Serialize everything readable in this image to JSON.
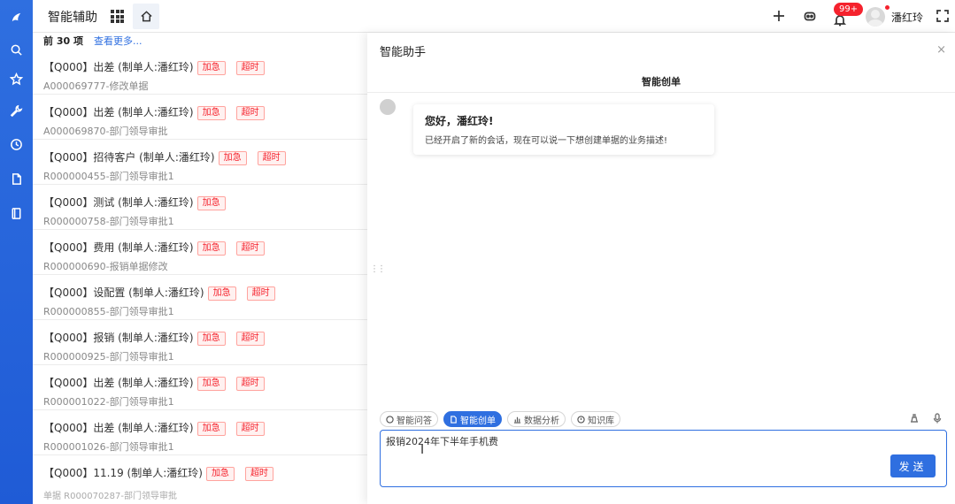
{
  "app": {
    "title": "智能辅助",
    "user": "潘红玲",
    "notification_count": "99+"
  },
  "list": {
    "header_count": "前 30 项",
    "header_more": "查看更多...",
    "rows": [
      {
        "title": "【Q000】出差 (制单人:潘红玲)",
        "tags": [
          "加急",
          "超时"
        ],
        "subtitle": "A000069777-修改单据"
      },
      {
        "title": "【Q000】出差 (制单人:潘红玲)",
        "tags": [
          "加急",
          "超时"
        ],
        "subtitle": "A000069870-部门领导审批"
      },
      {
        "title": "【Q000】招待客户 (制单人:潘红玲)",
        "tags": [
          "加急",
          "超时"
        ],
        "subtitle": "R000000455-部门领导审批1"
      },
      {
        "title": "【Q000】测试 (制单人:潘红玲)",
        "tags": [
          "加急"
        ],
        "subtitle": "R000000758-部门领导审批1"
      },
      {
        "title": "【Q000】费用 (制单人:潘红玲)",
        "tags": [
          "加急",
          "超时"
        ],
        "subtitle": "R000000690-报销单据修改"
      },
      {
        "title": "【Q000】设配置 (制单人:潘红玲)",
        "tags": [
          "加急",
          "超时"
        ],
        "subtitle": "R000000855-部门领导审批1"
      },
      {
        "title": "【Q000】报销 (制单人:潘红玲)",
        "tags": [
          "加急",
          "超时"
        ],
        "subtitle": "R000000925-部门领导审批1"
      },
      {
        "title": "【Q000】出差 (制单人:潘红玲)",
        "tags": [
          "加急",
          "超时"
        ],
        "subtitle": "R000001022-部门领导审批1"
      },
      {
        "title": "【Q000】出差 (制单人:潘红玲)",
        "tags": [
          "加急",
          "超时"
        ],
        "subtitle": "R000001026-部门领导审批1"
      },
      {
        "title": "【Q000】11.19 (制单人:潘红玲)",
        "tags": [
          "加急",
          "超时"
        ],
        "subtitle": ""
      }
    ],
    "footer": "单据 R000070287-部门领导审批"
  },
  "assistant": {
    "title": "智能助手",
    "close": "×",
    "sub_title": "智能创单",
    "greeting": "您好，潘红玲!",
    "message": "已经开启了新的会话，现在可以说一下想创建单据的业务描述!",
    "modes": [
      {
        "label": "智能问答",
        "icon": "chat-icon",
        "active": false
      },
      {
        "label": "智能创单",
        "icon": "doc-icon",
        "active": true
      },
      {
        "label": "数据分析",
        "icon": "chart-icon",
        "active": false
      },
      {
        "label": "知识库",
        "icon": "book-icon",
        "active": false
      }
    ],
    "input_value": "报销2024年下半年手机费",
    "send_label": "发送"
  },
  "colors": {
    "primary": "#2f6fe0",
    "danger": "#f5222d"
  }
}
